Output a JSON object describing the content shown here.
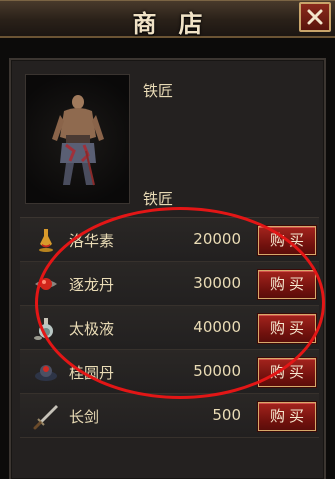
{
  "window": {
    "title": "商店",
    "close_icon": "close-x-icon"
  },
  "npc": {
    "name": "铁匠",
    "label": "铁匠"
  },
  "items": [
    {
      "name": "洛华素",
      "price": "20000",
      "buy_label": "购买",
      "icon": "potion-icon"
    },
    {
      "name": "逐龙丹",
      "price": "30000",
      "buy_label": "购买",
      "icon": "red-pill-icon"
    },
    {
      "name": "太极液",
      "price": "40000",
      "buy_label": "购买",
      "icon": "flask-icon"
    },
    {
      "name": "桂圆丹",
      "price": "50000",
      "buy_label": "购买",
      "icon": "dark-orb-icon"
    },
    {
      "name": "长剑",
      "price": "500",
      "buy_label": "购买",
      "icon": "sword-icon"
    }
  ],
  "colors": {
    "accent_red": "#a4231d",
    "annotation": "#e31616",
    "text": "#eadcb6"
  }
}
